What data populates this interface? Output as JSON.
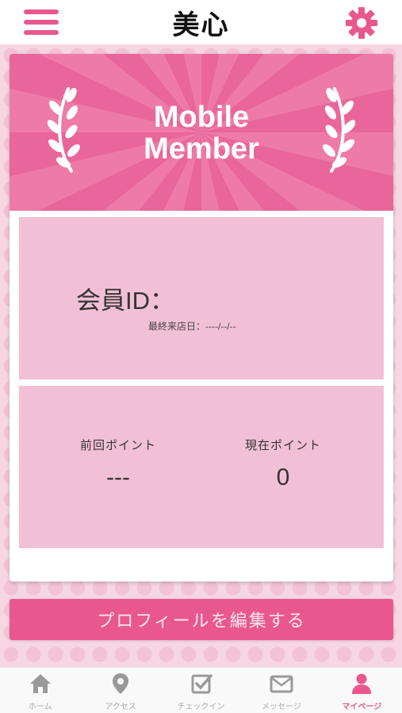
{
  "header": {
    "title": "美心",
    "menu_icon": "hamburger-menu-icon",
    "settings_icon": "gear-icon",
    "accent_color": "#e8588e"
  },
  "banner": {
    "title_line1": "Mobile",
    "title_line2": "Member",
    "background_color": "#e9669a",
    "decoration": "laurel-icon"
  },
  "member": {
    "id_label": "会員ID：",
    "last_visit": "最終来店日：----/--/--"
  },
  "points": {
    "previous_label": "前回ポイント",
    "previous_value": "---",
    "current_label": "現在ポイント",
    "current_value": "0"
  },
  "edit_profile_label": "プロフィールを編集する",
  "bottom_nav": {
    "items": [
      {
        "label": "ホーム",
        "icon": "home-icon",
        "active": false
      },
      {
        "label": "アクセス",
        "icon": "map-pin-icon",
        "active": false
      },
      {
        "label": "チェックイン",
        "icon": "checkbox-icon",
        "active": false
      },
      {
        "label": "メッセージ",
        "icon": "envelope-icon",
        "active": false
      },
      {
        "label": "マイページ",
        "icon": "person-icon",
        "active": true
      }
    ],
    "active_color": "#e8588e",
    "inactive_color": "#aaaaaa"
  }
}
